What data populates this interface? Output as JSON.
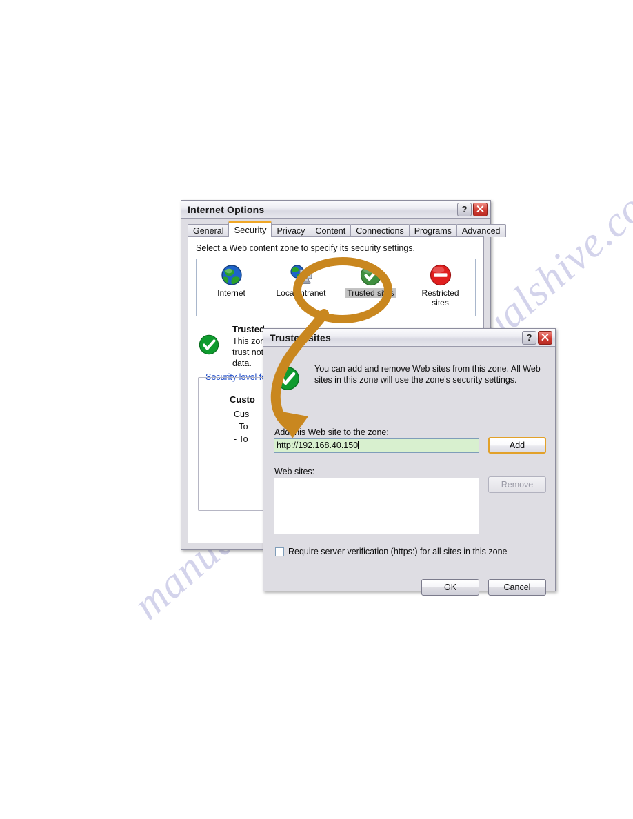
{
  "watermark": {
    "text": "manualshive.com"
  },
  "internet_options": {
    "title": "Internet Options",
    "titlebar_buttons": {
      "help": "?",
      "close": "close-icon"
    },
    "tabs": [
      {
        "label": "General",
        "active": false
      },
      {
        "label": "Security",
        "active": true
      },
      {
        "label": "Privacy",
        "active": false
      },
      {
        "label": "Content",
        "active": false
      },
      {
        "label": "Connections",
        "active": false
      },
      {
        "label": "Programs",
        "active": false
      },
      {
        "label": "Advanced",
        "active": false
      }
    ],
    "hint": "Select a Web content zone to specify its security settings.",
    "zones": [
      {
        "label": "Internet",
        "icon": "globe-icon",
        "selected": false
      },
      {
        "label": "Local intranet",
        "icon": "intranet-icon",
        "selected": false
      },
      {
        "label": "Trusted sites",
        "icon": "green-check-icon",
        "selected": true
      },
      {
        "label": "Restricted sites",
        "icon": "red-deny-icon",
        "selected": false
      }
    ],
    "zone_description": {
      "title": "Trusted",
      "line1": "This zone",
      "line2": "trust not to",
      "line3": "data."
    },
    "security_level_legend": "Security level fo",
    "level": {
      "title": "Custo",
      "line1": "Cus",
      "line2": "- To",
      "line3": "- To"
    }
  },
  "trusted_sites": {
    "title": "Trusted sites",
    "titlebar_buttons": {
      "help": "?",
      "close": "close-icon"
    },
    "banner": "You can add and remove Web sites from this zone. All Web sites in this zone will use the zone's security settings.",
    "add_label": "Add this Web site to the zone:",
    "url_value": "http://192.168.40.150",
    "add_button": "Add",
    "sites_label": "Web sites:",
    "sites_items": [],
    "remove_button": "Remove",
    "require_https_label": "Require server verification (https:) for all sites in this zone",
    "require_https_checked": false,
    "ok_button": "OK",
    "cancel_button": "Cancel"
  },
  "annotation": {
    "color": "#c9871f",
    "ellipse_target": "Trusted sites",
    "arrow_target": "url-input"
  }
}
